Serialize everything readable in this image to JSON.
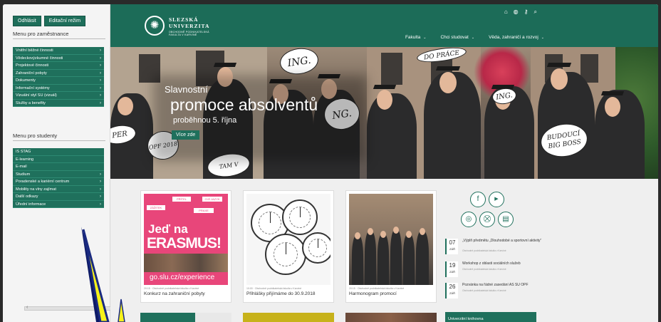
{
  "sidebar": {
    "buttons": [
      "Odhlásit",
      "Editační režim"
    ],
    "heading_staff": "Menu pro zaměstnance",
    "staff_items": [
      "Vnitřní běžné činnosti",
      "Vědeckovýzkumné činnosti",
      "Projektové činnosti",
      "Zahraniční pobyty",
      "Dokumenty",
      "Informační systémy",
      "Vizuální styl SU (vizuál)",
      "Služby a benefity"
    ],
    "heading_students": "Menu pro studenty",
    "student_items": [
      "IS STAG",
      "E-learning",
      "E-mail",
      "Studium",
      "Poradenské a kariérní centrum",
      "Mobility na vlny zajímat",
      "Další odkazy",
      "Úřední informace"
    ],
    "chevron": "›"
  },
  "header": {
    "logo_line1": "SLEZSKÁ",
    "logo_line2": "UNIVERZITA",
    "logo_line3": "OBCHODNĚ PODNIKATELSKÁ",
    "logo_line4": "FAKULTA V KARVINÉ",
    "nav": [
      "Fakulta",
      "Chci studovat",
      "Věda, zahraničí a rozvoj"
    ],
    "icons": [
      "home-icon",
      "globe-icon",
      "key-icon",
      "search-icon"
    ]
  },
  "hero": {
    "small": "Slavnostní",
    "big": "promoce absolventů",
    "sub": "proběhnou 5. října",
    "button": "Více zde",
    "bubbles": [
      "ING.",
      "DO PRÁCE",
      "NG.",
      "PER",
      "OPF 2018",
      "TAM V KARVINÉ",
      "ING.",
      "BUDOUCÍ BIG BOSS"
    ]
  },
  "erasmus": {
    "box1": "PŘÍTEL",
    "box2": "CIZÍ JAZYK",
    "box3": "ZÁŽITEK",
    "box4": "PRAXE",
    "jed": "Jeď na",
    "erasmus": "ERASMUS!",
    "url": "go.slu.cz/experience"
  },
  "cards": [
    {
      "meta": "20:15 · Obchodně podnikatelská fakulta v Karviné",
      "title": "Konkurz na zahraniční pobyty"
    },
    {
      "meta": "10:00 · Obchodně podnikatelská fakulta v Karviné",
      "title": "Přihlášky přijímáme do 30.9.2018"
    },
    {
      "meta": "20:15 · Obchodně podnikatelská fakulta v Karviné",
      "title": "Harmonogram promocí"
    }
  ],
  "events": [
    {
      "day": "07",
      "month": "ZÁŘ",
      "title": "„Výplň předmětu „Dlouhodobé a sportovní aktivity“",
      "sub": "Obchodně podnikatelská fakulta v Karviné"
    },
    {
      "day": "19",
      "month": "ZÁŘ",
      "title": "Workshop z oblasti sociálních služeb",
      "sub": "Obchodně podnikatelská fakulta v Karviné"
    },
    {
      "day": "26",
      "month": "ZÁŘ",
      "title": "Pozvánka na řádné zasedání AS SU OPF",
      "sub": "Obchodně podnikatelská fakulta v Karviné"
    }
  ],
  "library": "Univerzitní knihovna",
  "social_icons": [
    "facebook-icon",
    "youtube-icon",
    "instagram-icon",
    "cart-icon",
    "news-icon"
  ],
  "social_glyphs": [
    "f",
    "▶",
    "◎",
    "⛒",
    "▤"
  ],
  "colors": {
    "brand": "#1f705c",
    "erasmus": "#e8467a",
    "arrow": "#f7f21a"
  }
}
